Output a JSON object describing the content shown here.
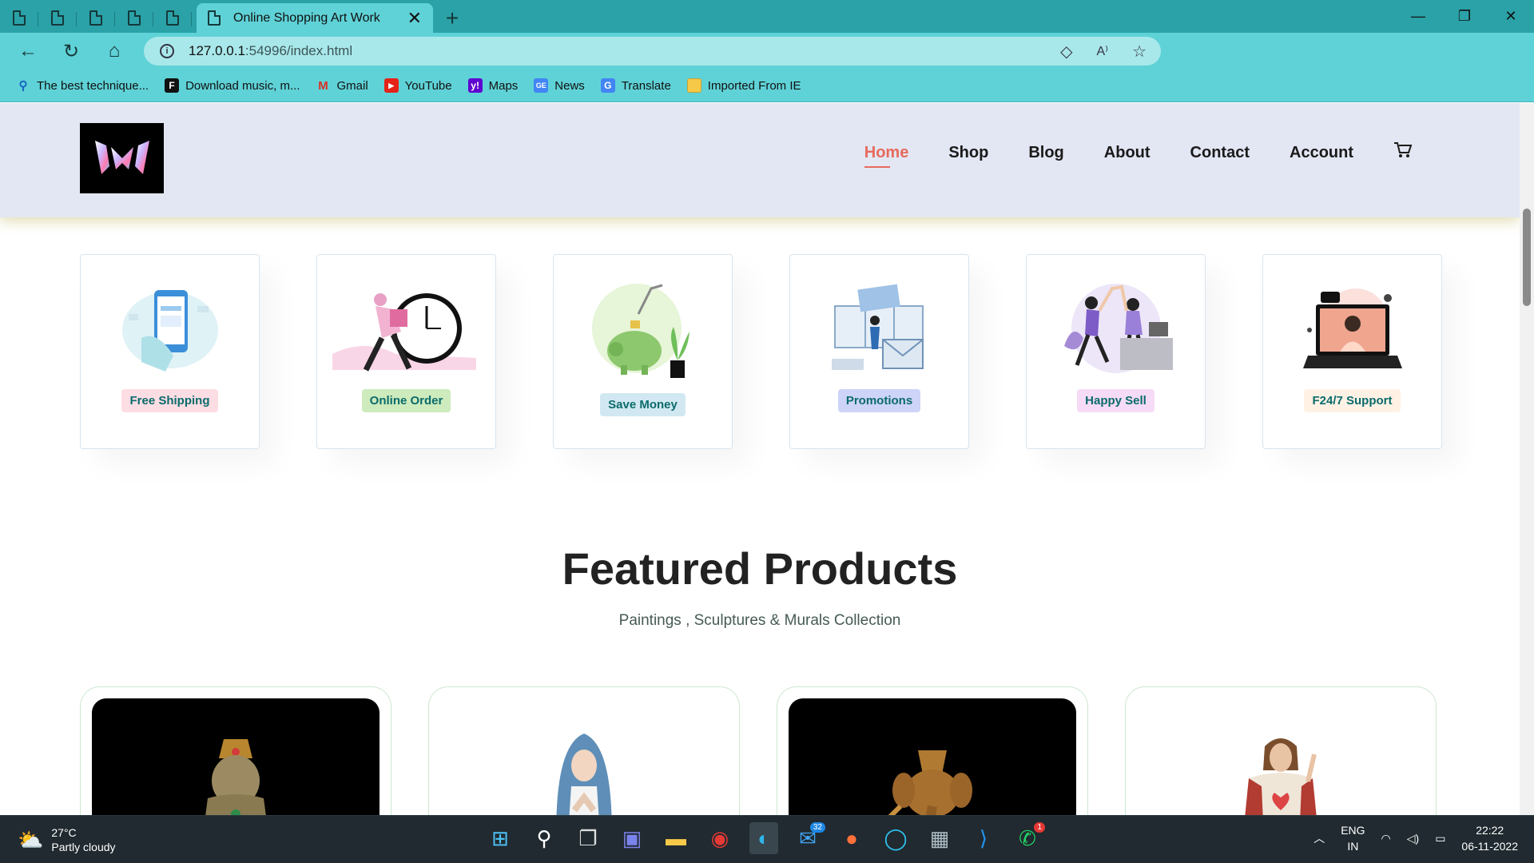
{
  "browser": {
    "tab_title": "Online Shopping Art Work",
    "url_host": "127.0.0.1",
    "url_path": ":54996/index.html",
    "bookmarks": [
      {
        "label": "The best technique...",
        "icon": "search-icon"
      },
      {
        "label": "Download music, m...",
        "icon": "f-icon"
      },
      {
        "label": "Gmail",
        "icon": "gmail-icon"
      },
      {
        "label": "YouTube",
        "icon": "youtube-icon"
      },
      {
        "label": "Maps",
        "icon": "yahoo-icon"
      },
      {
        "label": "News",
        "icon": "google-news-icon"
      },
      {
        "label": "Translate",
        "icon": "translate-icon"
      },
      {
        "label": "Imported From IE",
        "icon": "folder-icon"
      }
    ]
  },
  "site": {
    "nav": [
      "Home",
      "Shop",
      "Blog",
      "About",
      "Contact",
      "Account"
    ],
    "active_nav": "Home",
    "features": [
      {
        "label": "Free Shipping",
        "bg": "#fddde4"
      },
      {
        "label": "Online Order",
        "bg": "#cdebbc"
      },
      {
        "label": "Save Money",
        "bg": "#d1e8f2"
      },
      {
        "label": "Promotions",
        "bg": "#cdd4f8"
      },
      {
        "label": "Happy Sell",
        "bg": "#f6dbf6"
      },
      {
        "label": "F24/7 Support",
        "bg": "#fff2e5"
      }
    ],
    "featured_title": "Featured Products",
    "featured_subtitle": "Paintings , Sculptures & Murals Collection"
  },
  "taskbar": {
    "temp": "27°C",
    "weather": "Partly cloudy",
    "lang1": "ENG",
    "lang2": "IN",
    "time": "22:22",
    "date": "06-11-2022",
    "mail_badge": "32",
    "whatsapp_badge": "1"
  },
  "colors": {
    "accent": "#e76a5c",
    "browser_chrome": "#5fd2d7"
  }
}
